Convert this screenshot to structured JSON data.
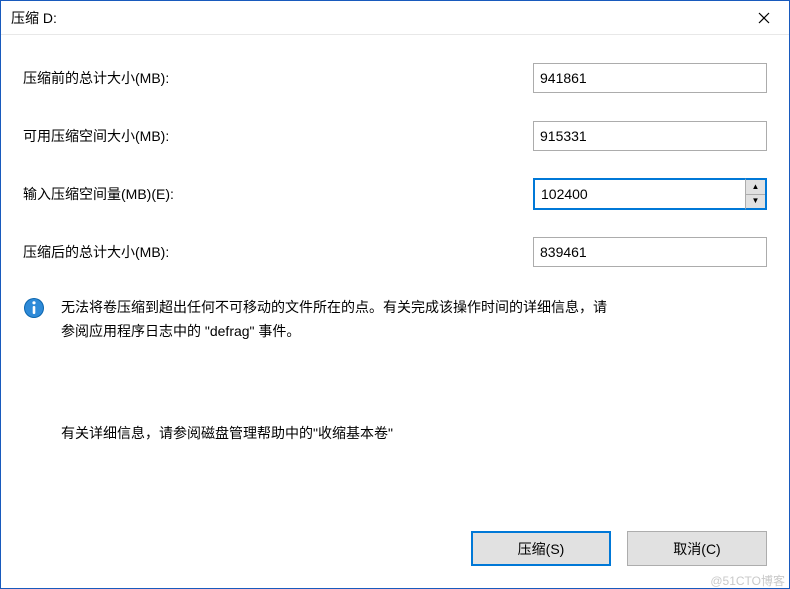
{
  "title": "压缩 D:",
  "fields": {
    "total_before": {
      "label": "压缩前的总计大小(MB):",
      "value": "941861"
    },
    "available": {
      "label": "可用压缩空间大小(MB):",
      "value": "915331"
    },
    "shrink_amt": {
      "label": "输入压缩空间量(MB)(E):",
      "value": "102400"
    },
    "total_after": {
      "label": "压缩后的总计大小(MB):",
      "value": "839461"
    }
  },
  "info": {
    "line1": "无法将卷压缩到超出任何不可移动的文件所在的点。有关完成该操作时间的详细信息，请",
    "line2": "参阅应用程序日志中的 \"defrag\" 事件。",
    "secondary": "有关详细信息，请参阅磁盘管理帮助中的\"收缩基本卷\""
  },
  "buttons": {
    "shrink": "压缩(S)",
    "cancel": "取消(C)"
  },
  "watermark": "@51CTO博客"
}
